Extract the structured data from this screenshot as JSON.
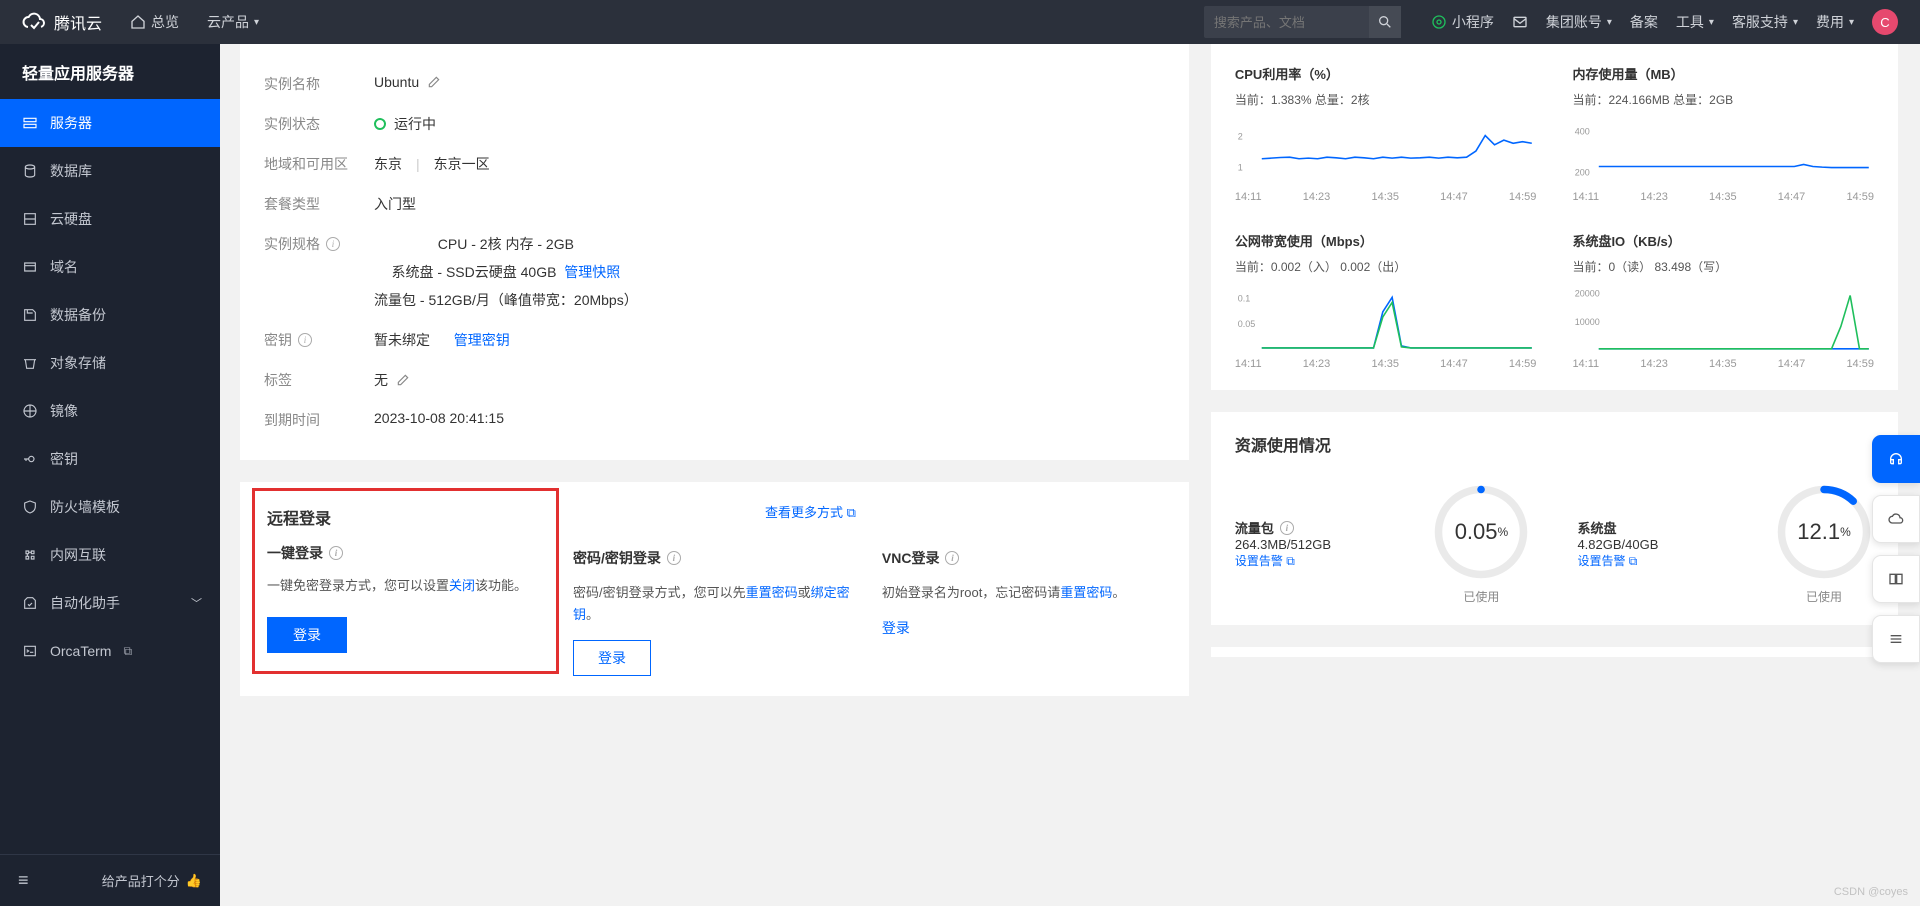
{
  "top": {
    "brand": "腾讯云",
    "overview": "总览",
    "products": "云产品",
    "search_ph": "搜索产品、文档",
    "miniprog": "小程序",
    "group": "集团账号",
    "beian": "备案",
    "tools": "工具",
    "support": "客服支持",
    "fee": "费用",
    "avatar": "C"
  },
  "sidebar": {
    "title": "轻量应用服务器",
    "items": [
      {
        "label": "服务器",
        "icon": "server"
      },
      {
        "label": "数据库",
        "icon": "db"
      },
      {
        "label": "云硬盘",
        "icon": "disk"
      },
      {
        "label": "域名",
        "icon": "domain"
      },
      {
        "label": "数据备份",
        "icon": "backup"
      },
      {
        "label": "对象存储",
        "icon": "bucket"
      },
      {
        "label": "镜像",
        "icon": "image"
      },
      {
        "label": "密钥",
        "icon": "key"
      },
      {
        "label": "防火墙模板",
        "icon": "shield"
      },
      {
        "label": "内网互联",
        "icon": "net"
      },
      {
        "label": "自动化助手",
        "icon": "auto",
        "expand": true
      },
      {
        "label": "OrcaTerm",
        "icon": "terminal",
        "ext": true
      }
    ],
    "rate": "给产品打个分",
    "collapse": "≡"
  },
  "info": {
    "name_l": "实例名称",
    "name_v": "Ubuntu",
    "state_l": "实例状态",
    "state_v": "运行中",
    "region_l": "地域和可用区",
    "region_a": "东京",
    "region_b": "东京一区",
    "plan_l": "套餐类型",
    "plan_v": "入门型",
    "spec_l": "实例规格",
    "spec_v": "CPU - 2核 内存 - 2GB",
    "disk_v": "系统盘 - SSD云硬盘 40GB",
    "disk_link": "管理快照",
    "traf_v": "流量包 - 512GB/月（峰值带宽：20Mbps）",
    "key_l": "密钥",
    "key_v": "暂未绑定",
    "key_link": "管理密钥",
    "tag_l": "标签",
    "tag_v": "无",
    "exp_l": "到期时间",
    "exp_v": "2023-10-08 20:41:15"
  },
  "login": {
    "title": "远程登录",
    "more": "查看更多方式",
    "c1_title": "一键登录",
    "c1_desc_a": "一键免密登录方式，您可以设置",
    "c1_desc_link": "关闭",
    "c1_desc_b": "该功能。",
    "c1_btn": "登录",
    "c2_title": "密码/密钥登录",
    "c2_desc_a": "密码/密钥登录方式，您可以先",
    "c2_link1": "重置密码",
    "c2_mid": "或",
    "c2_link2": "绑定密钥",
    "c2_tail": "。",
    "c2_btn": "登录",
    "c3_title": "VNC登录",
    "c3_desc_a": "初始登录名为root，忘记密码请",
    "c3_link": "重置密码",
    "c3_tail": "。",
    "c3_btn": "登录"
  },
  "usage": {
    "title": "资源使用情况",
    "a_name": "流量包",
    "a_val": "264.3MB/512GB",
    "a_link": "设置告警",
    "a_pct": "0.05",
    "b_name": "系统盘",
    "b_val": "4.82GB/40GB",
    "b_link": "设置告警",
    "b_pct": "12.1",
    "used": "已使用",
    "pct": "%"
  },
  "chart_data": [
    {
      "type": "line",
      "title": "CPU利用率（%）",
      "subtitle": "当前：1.383% 总量：2核",
      "x": [
        "14:11",
        "14:23",
        "14:35",
        "14:47",
        "14:59"
      ],
      "yticks": [
        1,
        2
      ],
      "ylim": [
        0.5,
        2.5
      ],
      "series": [
        {
          "name": "cpu",
          "color": "#0066ff",
          "values": [
            1.25,
            1.27,
            1.29,
            1.3,
            1.25,
            1.27,
            1.25,
            1.3,
            1.28,
            1.25,
            1.3,
            1.28,
            1.25,
            1.3,
            1.27,
            1.3,
            1.27,
            1.28,
            1.3,
            1.27,
            1.3,
            1.28,
            1.3,
            1.5,
            2.0,
            1.7,
            1.85,
            1.75,
            1.8,
            1.75
          ]
        }
      ]
    },
    {
      "type": "line",
      "title": "内存使用量（MB）",
      "subtitle": "当前：224.166MB 总量：2GB",
      "x": [
        "14:11",
        "14:23",
        "14:35",
        "14:47",
        "14:59"
      ],
      "yticks": [
        200,
        400
      ],
      "ylim": [
        150,
        450
      ],
      "series": [
        {
          "name": "mem",
          "color": "#0066ff",
          "values": [
            225,
            225,
            225,
            225,
            225,
            225,
            225,
            225,
            225,
            225,
            225,
            225,
            225,
            225,
            225,
            225,
            225,
            225,
            225,
            225,
            225,
            225,
            235,
            225,
            222,
            220,
            220,
            220,
            220,
            220
          ]
        }
      ]
    },
    {
      "type": "line",
      "title": "公网带宽使用（Mbps）",
      "subtitle": "当前：0.002（入） 0.002（出）",
      "x": [
        "14:11",
        "14:23",
        "14:35",
        "14:47",
        "14:59"
      ],
      "yticks": [
        0.05,
        0.1
      ],
      "ylim": [
        0,
        0.12
      ],
      "series": [
        {
          "name": "in",
          "color": "#0066ff",
          "values": [
            0.002,
            0.002,
            0.002,
            0.002,
            0.002,
            0.002,
            0.002,
            0.002,
            0.002,
            0.002,
            0.002,
            0.002,
            0.002,
            0.072,
            0.1,
            0.006,
            0.002,
            0.002,
            0.002,
            0.002,
            0.002,
            0.002,
            0.002,
            0.002,
            0.002,
            0.002,
            0.002,
            0.002,
            0.002,
            0.002
          ]
        },
        {
          "name": "out",
          "color": "#1fbf5c",
          "values": [
            0.002,
            0.002,
            0.002,
            0.002,
            0.002,
            0.002,
            0.002,
            0.002,
            0.002,
            0.002,
            0.002,
            0.002,
            0.002,
            0.062,
            0.09,
            0.004,
            0.002,
            0.002,
            0.002,
            0.002,
            0.002,
            0.002,
            0.002,
            0.002,
            0.002,
            0.002,
            0.002,
            0.002,
            0.002,
            0.002
          ]
        }
      ]
    },
    {
      "type": "line",
      "title": "系统盘IO（KB/s）",
      "subtitle": "当前：0（读） 83.498（写）",
      "x": [
        "14:11",
        "14:23",
        "14:35",
        "14:47",
        "14:59"
      ],
      "yticks": [
        10000,
        20000
      ],
      "ylim": [
        0,
        22000
      ],
      "series": [
        {
          "name": "read",
          "color": "#0066ff",
          "values": [
            80,
            80,
            80,
            80,
            80,
            80,
            80,
            80,
            80,
            80,
            80,
            80,
            80,
            80,
            80,
            80,
            80,
            80,
            80,
            80,
            80,
            80,
            80,
            80,
            80,
            80,
            80,
            80,
            80,
            80
          ]
        },
        {
          "name": "write",
          "color": "#1fbf5c",
          "values": [
            80,
            80,
            80,
            80,
            80,
            80,
            80,
            80,
            80,
            80,
            80,
            80,
            80,
            80,
            80,
            80,
            80,
            80,
            80,
            80,
            80,
            80,
            80,
            80,
            80,
            80,
            8000,
            19000,
            80,
            80
          ]
        }
      ]
    }
  ],
  "watermark": "CSDN @coyes"
}
